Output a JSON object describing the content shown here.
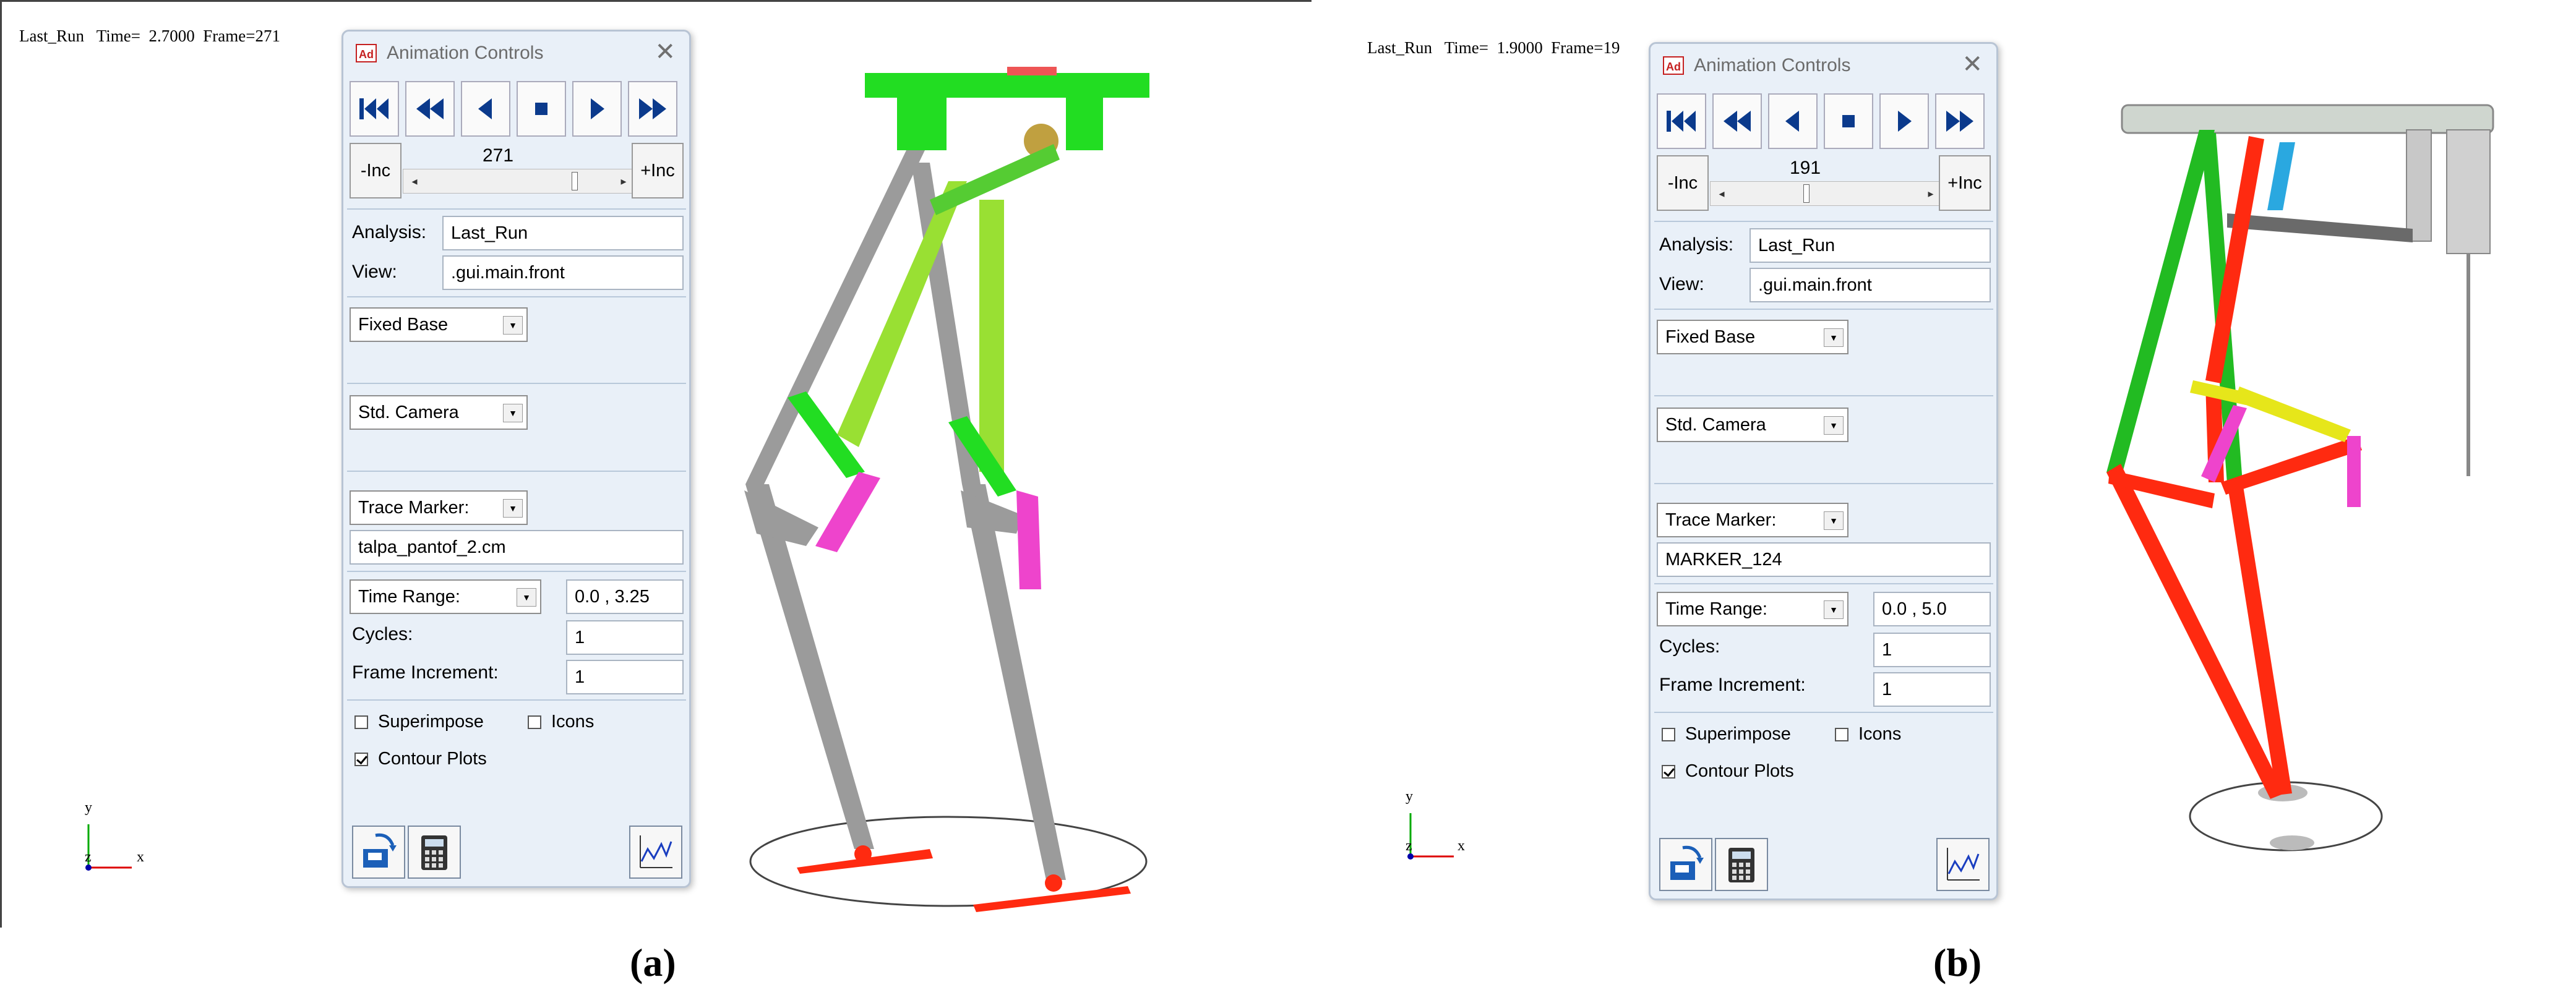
{
  "panels": [
    {
      "status_line": "Last_Run   Time=  2.7000  Frame=271",
      "window_title": "Animation Controls",
      "logo_text": "Ad",
      "close_glyph": "✕",
      "minus_inc_label": "-Inc",
      "plus_inc_label": "+Inc",
      "frame_value": "271",
      "analysis_label": "Analysis:",
      "analysis_value": "Last_Run",
      "view_label": "View:",
      "view_value": ".gui.main.front",
      "base_select": "Fixed Base",
      "camera_select": "Std. Camera",
      "trace_select": "Trace Marker:",
      "trace_value": "talpa_pantof_2.cm",
      "time_select": "Time Range:",
      "time_value": "0.0 , 3.25",
      "cycles_label": "Cycles:",
      "cycles_value": "1",
      "frame_inc_label": "Frame Increment:",
      "frame_inc_value": "1",
      "superimpose_label": "Superimpose",
      "superimpose_checked": false,
      "icons_label": "Icons",
      "icons_checked": false,
      "contour_label": "Contour Plots",
      "contour_checked": true,
      "axis_y": "y",
      "axis_z": "z",
      "axis_x": "x",
      "caption": "(a)"
    },
    {
      "status_line": "Last_Run   Time=  1.9000  Frame=19",
      "window_title": "Animation Controls",
      "logo_text": "Ad",
      "close_glyph": "✕",
      "minus_inc_label": "-Inc",
      "plus_inc_label": "+Inc",
      "frame_value": "191",
      "analysis_label": "Analysis:",
      "analysis_value": "Last_Run",
      "view_label": "View:",
      "view_value": ".gui.main.front",
      "base_select": "Fixed Base",
      "camera_select": "Std. Camera",
      "trace_select": "Trace Marker:",
      "trace_value": "MARKER_124",
      "time_select": "Time Range:",
      "time_value": "0.0 , 5.0",
      "cycles_label": "Cycles:",
      "cycles_value": "1",
      "frame_inc_label": "Frame Increment:",
      "frame_inc_value": "1",
      "superimpose_label": "Superimpose",
      "superimpose_checked": false,
      "icons_label": "Icons",
      "icons_checked": false,
      "contour_label": "Contour Plots",
      "contour_checked": true,
      "axis_y": "y",
      "axis_z": "z",
      "axis_x": "x",
      "caption": "(b)"
    }
  ],
  "icons": {
    "playback": [
      "skip-to-start-icon",
      "rewind-icon",
      "play-reverse-icon",
      "stop-icon",
      "play-forward-icon",
      "fast-forward-icon"
    ],
    "tools": [
      "save-animation-icon",
      "calculator-icon",
      "plot-icon"
    ]
  },
  "colors": {
    "icon_blue": "#0b3a8c",
    "panel_bg": "#e9f0f8",
    "link_gray": "#9b9b9b",
    "link_green": "#22dd22",
    "link_lime": "#99e033",
    "link_magenta": "#ee44cc",
    "link_red": "#ff2a10",
    "link_yellow": "#e6e61a",
    "link_cyan": "#2aa8e0"
  }
}
